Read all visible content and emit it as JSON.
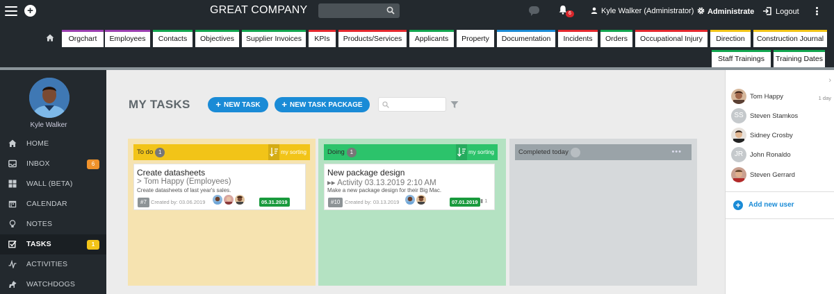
{
  "header": {
    "company": "GREAT COMPANY",
    "notif_count": "6",
    "user": "Kyle Walker (Administrator)",
    "administrate": "Administrate",
    "logout": "Logout"
  },
  "tabs": [
    {
      "label": "Orgchart",
      "color": "#9b3fb0"
    },
    {
      "label": "Employees",
      "color": "#9b3fb0"
    },
    {
      "label": "Contacts",
      "color": "#12a64f"
    },
    {
      "label": "Objectives",
      "color": "#12a64f"
    },
    {
      "label": "Supplier Invoices",
      "color": "#12a64f"
    },
    {
      "label": "KPIs",
      "color": "#e6282e"
    },
    {
      "label": "Products/Services",
      "color": "#e6282e"
    },
    {
      "label": "Applicants",
      "color": "#12a64f"
    },
    {
      "label": "Property",
      "color": "#ffffff"
    },
    {
      "label": "Documentation",
      "color": "#1a8bd6"
    },
    {
      "label": "Incidents",
      "color": "#e6282e"
    },
    {
      "label": "Orders",
      "color": "#12a64f"
    },
    {
      "label": "Occupational Injury",
      "color": "#e6282e"
    },
    {
      "label": "Direction",
      "color": "#f2c418"
    },
    {
      "label": "Construction Journal",
      "color": "#f2c418"
    },
    {
      "label": "Staff Trainings",
      "color": "#12a64f"
    },
    {
      "label": "Training Dates",
      "color": "#12a64f"
    }
  ],
  "sidebar": {
    "name": "Kyle Walker",
    "items": [
      {
        "label": "HOME",
        "icon": "home-icon",
        "badge": ""
      },
      {
        "label": "INBOX",
        "icon": "inbox-icon",
        "badge": "6",
        "badge_color": "#f0922b"
      },
      {
        "label": "WALL (BETA)",
        "icon": "grid-icon",
        "badge": ""
      },
      {
        "label": "CALENDAR",
        "icon": "calendar-icon",
        "badge": ""
      },
      {
        "label": "NOTES",
        "icon": "lightbulb-icon",
        "badge": ""
      },
      {
        "label": "TASKS",
        "icon": "checkbox-icon",
        "badge": "1",
        "badge_color": "#f2c418"
      },
      {
        "label": "ACTIVITIES",
        "icon": "activity-icon",
        "badge": ""
      },
      {
        "label": "WATCHDOGS",
        "icon": "dog-icon",
        "badge": ""
      }
    ]
  },
  "main": {
    "title": "MY TASKS",
    "new_task": "NEW TASK",
    "new_package": "NEW TASK PACKAGE",
    "search_placeholder": ""
  },
  "columns": [
    {
      "title": "To do",
      "count": "1",
      "sort": "my sorting",
      "head_color": "#f2c418",
      "bg_color": "#f6e3b0",
      "card": {
        "title": "Create datasheets",
        "subtitle": "> Tom Happy (Employees)",
        "desc": "Create datasheets of last year's sales.",
        "id": "#7",
        "created": "Created by: 03.06.2019",
        "date": "05.31.2019",
        "comments": ""
      }
    },
    {
      "title": "Doing",
      "count": "1",
      "sort": "my sorting",
      "head_color": "#2cc36b",
      "bg_color": "#b4e2c2",
      "card": {
        "title": "New package design",
        "subtitle": "▸▸ Activity 03.13.2019 2:10 AM",
        "desc": "Make a new package design for their Big Mac.",
        "id": "#10",
        "created": "Created by: 03.13.2019",
        "date": "07.01.2019",
        "comments": "1"
      }
    },
    {
      "title": "Completed today",
      "count": "0",
      "head_color": "#9aa3a8",
      "bg_color": "#d6d9db"
    }
  ],
  "right_panel": {
    "users": [
      {
        "name": "Tom Happy",
        "time": "1 day",
        "initials": ""
      },
      {
        "name": "Steven Stamkos",
        "initials": "SS"
      },
      {
        "name": "Sidney Crosby",
        "initials": ""
      },
      {
        "name": "John Ronaldo",
        "initials": "JR"
      },
      {
        "name": "Steven Gerrard",
        "initials": ""
      }
    ],
    "add_user": "Add new user"
  }
}
